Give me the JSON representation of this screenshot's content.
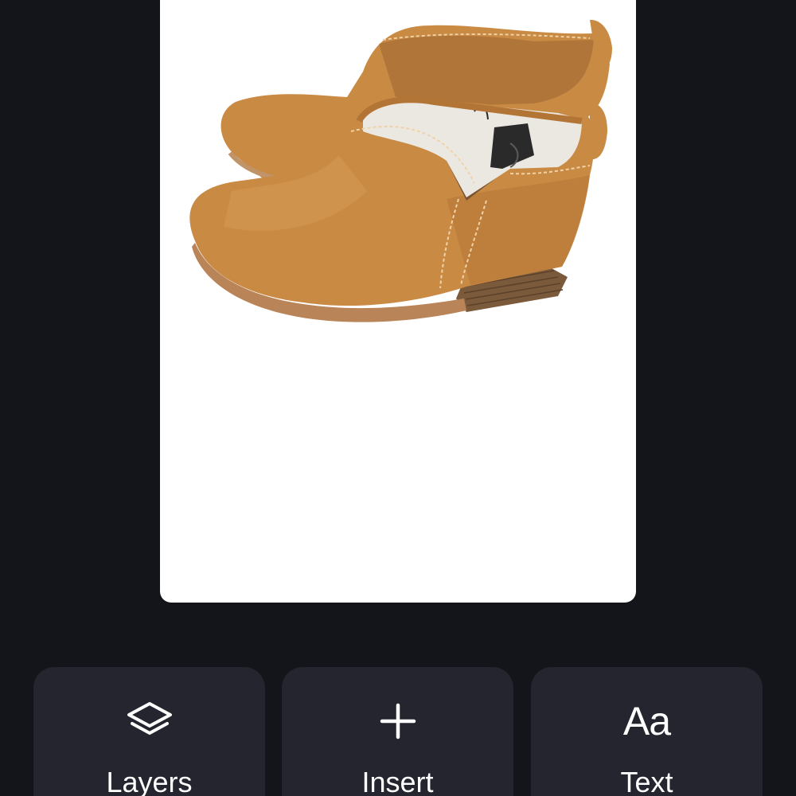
{
  "canvas": {
    "image_subject": "tan-ankle-boots-photo",
    "colors": {
      "leather": "#c98a44",
      "leather_dark": "#a8692e",
      "sole": "#7b5a3c",
      "stitch": "#f1d2a8",
      "insole": "#ebe8e2",
      "tag": "#2a2a2a"
    }
  },
  "toolbar": {
    "layers": {
      "label": "Layers",
      "icon": "layers-icon"
    },
    "insert": {
      "label": "Insert",
      "icon": "plus-icon"
    },
    "text": {
      "label": "Text",
      "icon": "text-aa-icon",
      "glyph": "Aa"
    }
  },
  "theme": {
    "background": "#14141b",
    "button_bg": "#24252e",
    "foreground": "#ffffff"
  }
}
